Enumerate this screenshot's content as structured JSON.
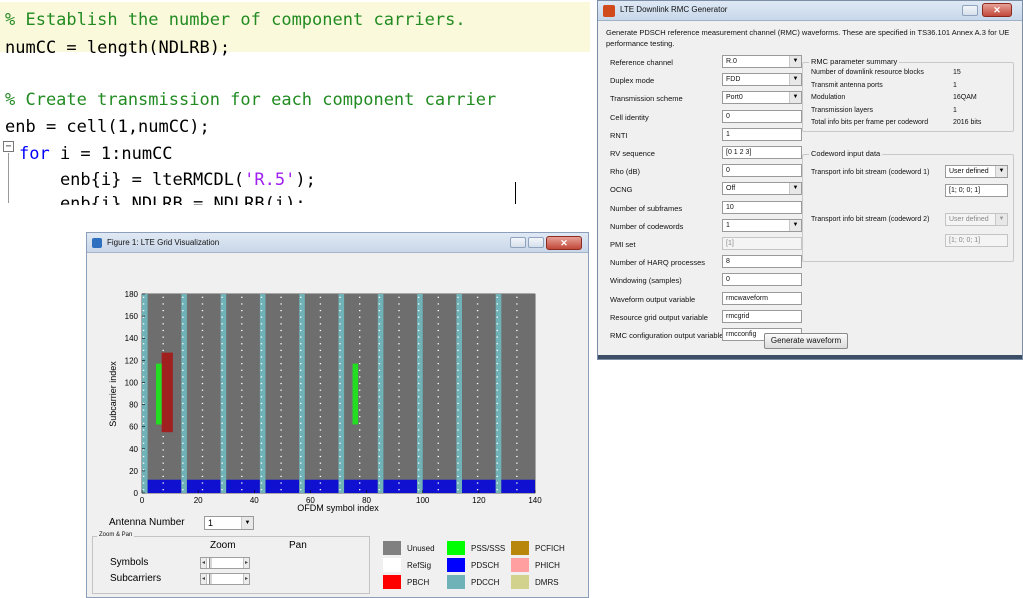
{
  "code_editor": {
    "lines": [
      {
        "comment": "% Establish the number of component carriers."
      },
      {
        "text": "numCC = length(NDLRB);"
      },
      {
        "comment": "% Create transmission for each component carrier"
      },
      {
        "text": "enb = cell(1,numCC);"
      },
      {
        "kw": "for",
        "rest": " i = 1:numCC"
      },
      {
        "pre": "    enb{i} = lteRMCDL(",
        "str": "'R.5'",
        "post": ");"
      },
      {
        "text": "    enb{i}.NDLRB = NDLRB(i);"
      }
    ],
    "fold_symbol": "−"
  },
  "rmc_window": {
    "title": "LTE Downlink RMC Generator",
    "close_glyph": "✕",
    "description": "Generate PDSCH reference measurement channel (RMC) waveforms. These are specified in TS36.101 Annex A.3 for UE performance testing.",
    "fields": [
      {
        "label": "Reference channel",
        "value": "R.0",
        "kind": "select"
      },
      {
        "label": "Duplex mode",
        "value": "FDD",
        "kind": "select"
      },
      {
        "label": "Transmission scheme",
        "value": "Port0",
        "kind": "select"
      },
      {
        "label": "Cell identity",
        "value": "0",
        "kind": "input"
      },
      {
        "label": "RNTI",
        "value": "1",
        "kind": "input"
      },
      {
        "label": "RV sequence",
        "value": "[0 1 2 3]",
        "kind": "input"
      },
      {
        "label": "Rho (dB)",
        "value": "0",
        "kind": "input"
      },
      {
        "label": "OCNG",
        "value": "Off",
        "kind": "select"
      },
      {
        "label": "Number of subframes",
        "value": "10",
        "kind": "input"
      },
      {
        "label": "Number of codewords",
        "value": "1",
        "kind": "select"
      },
      {
        "label": "PMI set",
        "value": "[1]",
        "kind": "disabled"
      },
      {
        "label": "Number of HARQ processes",
        "value": "8",
        "kind": "input"
      },
      {
        "label": "Windowing (samples)",
        "value": "0",
        "kind": "input"
      },
      {
        "label": "Waveform output variable",
        "value": "rmcwaveform",
        "kind": "input"
      },
      {
        "label": "Resource grid output variable",
        "value": "rmcgrid",
        "kind": "input"
      },
      {
        "label": "RMC configuration output variable",
        "value": "rmcconfig",
        "kind": "input"
      }
    ],
    "summary": {
      "title": "RMC parameter summary",
      "rows": [
        {
          "label": "Number of downlink resource blocks",
          "value": "15"
        },
        {
          "label": "Transmit antenna ports",
          "value": "1"
        },
        {
          "label": "Modulation",
          "value": "16QAM"
        },
        {
          "label": "Transmission layers",
          "value": "1"
        },
        {
          "label": "Total info bits per frame per codeword",
          "value": "2016 bits"
        }
      ]
    },
    "codeword": {
      "title": "Codeword input data",
      "cw1_label": "Transport info bit stream (codeword 1)",
      "cw1_select": "User defined",
      "cw1_value": "[1; 0; 0; 1]",
      "cw2_label": "Transport info bit stream (codeword 2)",
      "cw2_select": "User defined",
      "cw2_value": "[1; 0; 0; 1]"
    },
    "generate_label": "Generate waveform"
  },
  "figure_window": {
    "title": "Figure 1: LTE Grid Visualization",
    "close_glyph": "✕",
    "antenna_label": "Antenna Number",
    "antenna_value": "1",
    "zoom_group_title": "Zoom & Pan",
    "zoom_header": "Zoom",
    "pan_header": "Pan",
    "symbols_label": "Symbols",
    "subcarriers_label": "Subcarriers",
    "legend": [
      {
        "label": "Unused",
        "color": "#808080"
      },
      {
        "label": "RefSig",
        "color": "#ffffff"
      },
      {
        "label": "PBCH",
        "color": "#ff0000"
      },
      {
        "label": "PSS/SSS",
        "color": "#00ff00"
      },
      {
        "label": "PDSCH",
        "color": "#0000ff"
      },
      {
        "label": "PDCCH",
        "color": "#6fb3b8"
      },
      {
        "label": "PCFICH",
        "color": "#b8860b"
      },
      {
        "label": "PHICH",
        "color": "#ff9f9f"
      },
      {
        "label": "DMRS",
        "color": "#d2d28c"
      }
    ]
  },
  "chart_data": {
    "type": "heatmap",
    "xlabel": "OFDM symbol index",
    "ylabel": "Subcarrier index",
    "xlim": [
      0,
      140
    ],
    "ylim": [
      0,
      180
    ],
    "xticks": [
      0,
      20,
      40,
      60,
      80,
      100,
      120,
      140
    ],
    "yticks": [
      0,
      20,
      40,
      60,
      80,
      100,
      120,
      140,
      160,
      180
    ],
    "colors": {
      "unused": "#6e6e6e",
      "pdcch": "#6fb3b8",
      "pdsch": "#1010d0",
      "pbch": "#a02020",
      "pss_sss": "#22dd22",
      "refsig": "#ffffff"
    },
    "subframe_period": 14,
    "control_symbols_per_subframe": 2,
    "pdsch_subcarrier_range": [
      0,
      12
    ],
    "pbch": {
      "x": [
        7,
        11
      ],
      "y": [
        55,
        127
      ]
    },
    "pss_sss": [
      {
        "x": [
          5,
          7
        ],
        "y": [
          62,
          117
        ]
      },
      {
        "x": [
          75,
          77
        ],
        "y": [
          62,
          117
        ]
      }
    ]
  }
}
